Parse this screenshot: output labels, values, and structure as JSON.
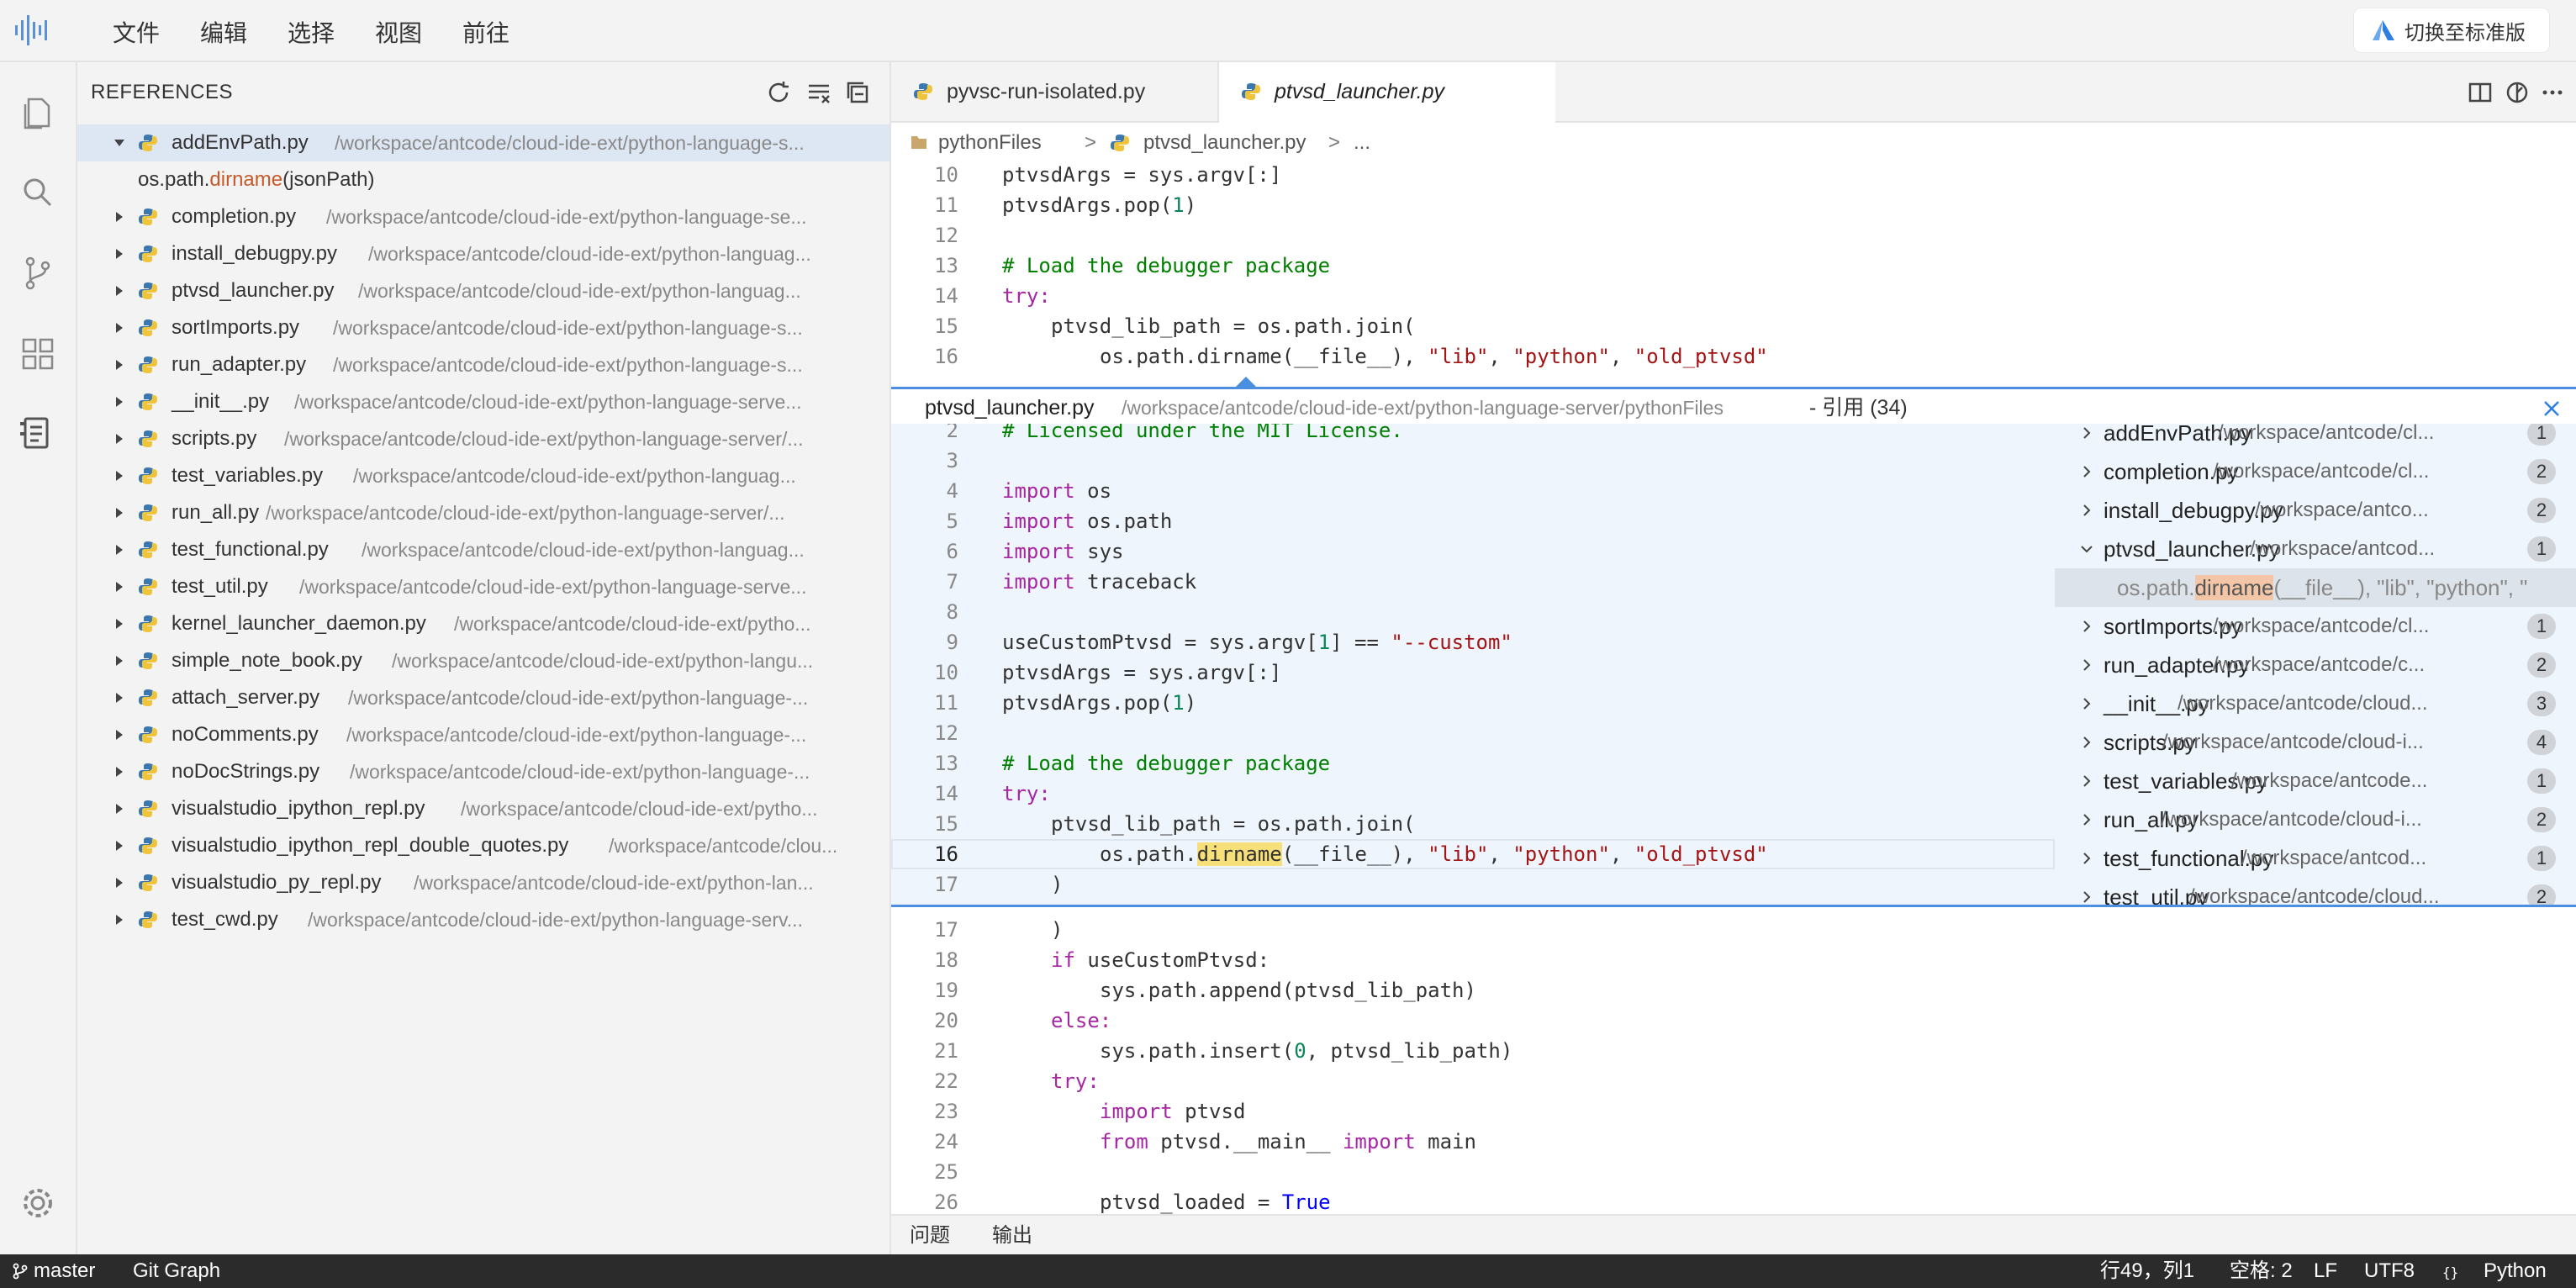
{
  "menu": [
    "文件",
    "编辑",
    "选择",
    "视图",
    "前往"
  ],
  "switch_label": "切换至标准版",
  "sidebar": {
    "title": "REFERENCES",
    "selected": {
      "name": "addEnvPath.py",
      "path": "/workspace/antcode/cloud-ide-ext/python-language-s..."
    },
    "selected_match": {
      "pre": "os.path.",
      "hl": "dirname",
      "post": "(jsonPath)"
    },
    "files": [
      {
        "name": "completion.py",
        "path": "/workspace/antcode/cloud-ide-ext/python-language-se..."
      },
      {
        "name": "install_debugpy.py",
        "path": "/workspace/antcode/cloud-ide-ext/python-languag..."
      },
      {
        "name": "ptvsd_launcher.py",
        "path": "/workspace/antcode/cloud-ide-ext/python-languag..."
      },
      {
        "name": "sortImports.py",
        "path": "/workspace/antcode/cloud-ide-ext/python-language-s..."
      },
      {
        "name": "run_adapter.py",
        "path": "/workspace/antcode/cloud-ide-ext/python-language-s..."
      },
      {
        "name": "__init__.py",
        "path": "/workspace/antcode/cloud-ide-ext/python-language-serve..."
      },
      {
        "name": "scripts.py",
        "path": "/workspace/antcode/cloud-ide-ext/python-language-server/..."
      },
      {
        "name": "test_variables.py",
        "path": "/workspace/antcode/cloud-ide-ext/python-languag..."
      },
      {
        "name": "run_all.py",
        "path": "/workspace/antcode/cloud-ide-ext/python-language-server/..."
      },
      {
        "name": "test_functional.py",
        "path": "/workspace/antcode/cloud-ide-ext/python-languag..."
      },
      {
        "name": "test_util.py",
        "path": "/workspace/antcode/cloud-ide-ext/python-language-serve..."
      },
      {
        "name": "kernel_launcher_daemon.py",
        "path": "/workspace/antcode/cloud-ide-ext/pytho..."
      },
      {
        "name": "simple_note_book.py",
        "path": "/workspace/antcode/cloud-ide-ext/python-langu..."
      },
      {
        "name": "attach_server.py",
        "path": "/workspace/antcode/cloud-ide-ext/python-language-..."
      },
      {
        "name": "noComments.py",
        "path": "/workspace/antcode/cloud-ide-ext/python-language-..."
      },
      {
        "name": "noDocStrings.py",
        "path": "/workspace/antcode/cloud-ide-ext/python-language-..."
      },
      {
        "name": "visualstudio_ipython_repl.py",
        "path": "/workspace/antcode/cloud-ide-ext/pytho..."
      },
      {
        "name": "visualstudio_ipython_repl_double_quotes.py",
        "path": "/workspace/antcode/clou..."
      },
      {
        "name": "visualstudio_py_repl.py",
        "path": "/workspace/antcode/cloud-ide-ext/python-lan..."
      },
      {
        "name": "test_cwd.py",
        "path": "/workspace/antcode/cloud-ide-ext/python-language-serv..."
      }
    ]
  },
  "tabs": [
    {
      "label": "pyvsc-run-isolated.py"
    },
    {
      "label": "ptvsd_launcher.py"
    }
  ],
  "breadcrumb": {
    "folder": "pythonFiles",
    "file": "ptvsd_launcher.py",
    "more": "..."
  },
  "peek": {
    "file": "ptvsd_launcher.py",
    "path": "/workspace/antcode/cloud-ide-ext/python-language-server/pythonFiles",
    "refs": "- 引用 (34)",
    "list": [
      {
        "name": "addEnvPath.py",
        "path": "/workspace/antcode/cl...",
        "count": "1",
        "expanded": false
      },
      {
        "name": "completion.py",
        "path": "/workspace/antcode/cl...",
        "count": "2",
        "expanded": false
      },
      {
        "name": "install_debugpy.py",
        "path": "/workspace/antco...",
        "count": "2",
        "expanded": false
      },
      {
        "name": "ptvsd_launcher.py",
        "path": "/workspace/antcod...",
        "count": "1",
        "expanded": true
      },
      {
        "name": "sortImports.py",
        "path": "/workspace/antcode/cl...",
        "count": "1",
        "expanded": false
      },
      {
        "name": "run_adapter.py",
        "path": "/workspace/antcode/c...",
        "count": "2",
        "expanded": false
      },
      {
        "name": "__init__.py",
        "path": "/workspace/antcode/cloud...",
        "count": "3",
        "expanded": false
      },
      {
        "name": "scripts.py",
        "path": "/workspace/antcode/cloud-i...",
        "count": "4",
        "expanded": false
      },
      {
        "name": "test_variables.py",
        "path": "/workspace/antcode...",
        "count": "1",
        "expanded": false
      },
      {
        "name": "run_all.py",
        "path": "/workspace/antcode/cloud-i...",
        "count": "2",
        "expanded": false
      },
      {
        "name": "test_functional.py",
        "path": "/workspace/antcod...",
        "count": "1",
        "expanded": false
      },
      {
        "name": "test_util.py",
        "path": "/workspace/antcode/cloud...",
        "count": "2",
        "expanded": false
      }
    ],
    "match": {
      "pre": "os.path.",
      "hl": "dirname",
      "post": "(__file__), \"lib\", \"python\", \""
    }
  },
  "panel_tabs": [
    "问题",
    "输出"
  ],
  "status": {
    "branch": "master",
    "git_graph": "Git Graph",
    "position": "行49，列1",
    "spaces": "空格: 2",
    "eol": "LF",
    "encoding": "UTF8",
    "language": "Python"
  }
}
